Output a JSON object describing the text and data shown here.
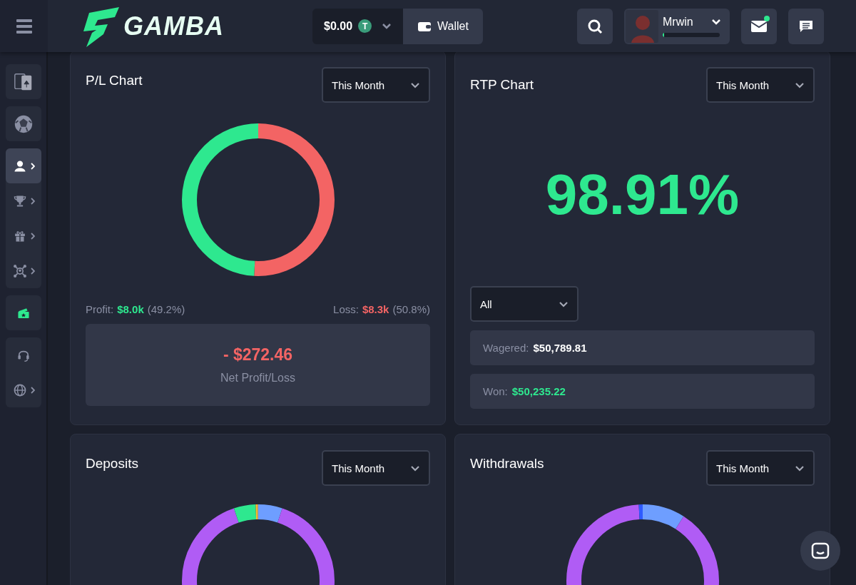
{
  "header": {
    "brand": "GAMBA",
    "balance": "$0.00",
    "currency_symbol": "T",
    "wallet_button": "Wallet",
    "username": "Mrwin",
    "xp": {
      "level": 0.03
    },
    "mail_unread": true
  },
  "sidebar": {
    "groups": [
      {
        "items": [
          {
            "selected": false,
            "submenu": false
          }
        ]
      },
      {
        "items": [
          {
            "selected": false,
            "submenu": false
          }
        ]
      },
      {
        "items": [
          {
            "selected": true,
            "submenu": true
          },
          {
            "selected": false,
            "submenu": true
          },
          {
            "selected": false,
            "submenu": true
          },
          {
            "selected": false,
            "submenu": true
          }
        ]
      },
      {
        "items": [
          {
            "selected": false,
            "submenu": false
          }
        ]
      },
      {
        "items": [
          {
            "selected": false,
            "submenu": false
          },
          {
            "selected": false,
            "submenu": true
          }
        ]
      }
    ]
  },
  "pl_card": {
    "title": "P/L Chart",
    "period": "This Month",
    "profit": {
      "label": "Profit:",
      "amount": "$8.0k",
      "share": "(49.2%)"
    },
    "loss": {
      "label": "Loss:",
      "amount": "$8.3k",
      "share": "(50.8%)"
    },
    "net_value": "- $272.46",
    "net_label": "Net Profit/Loss"
  },
  "rtp_card": {
    "title": "RTP Chart",
    "period": "This Month",
    "rtp": "98.91%",
    "filter": "All",
    "stats": [
      {
        "label": "Wagered:",
        "value": "$50,789.81",
        "kind": "neutral"
      },
      {
        "label": "Won:",
        "value": "$50,235.22",
        "kind": "positive"
      }
    ]
  },
  "deposits_card": {
    "title": "Deposits",
    "period": "This Month"
  },
  "withdrawals_card": {
    "title": "Withdrawals",
    "period": "This Month"
  }
}
